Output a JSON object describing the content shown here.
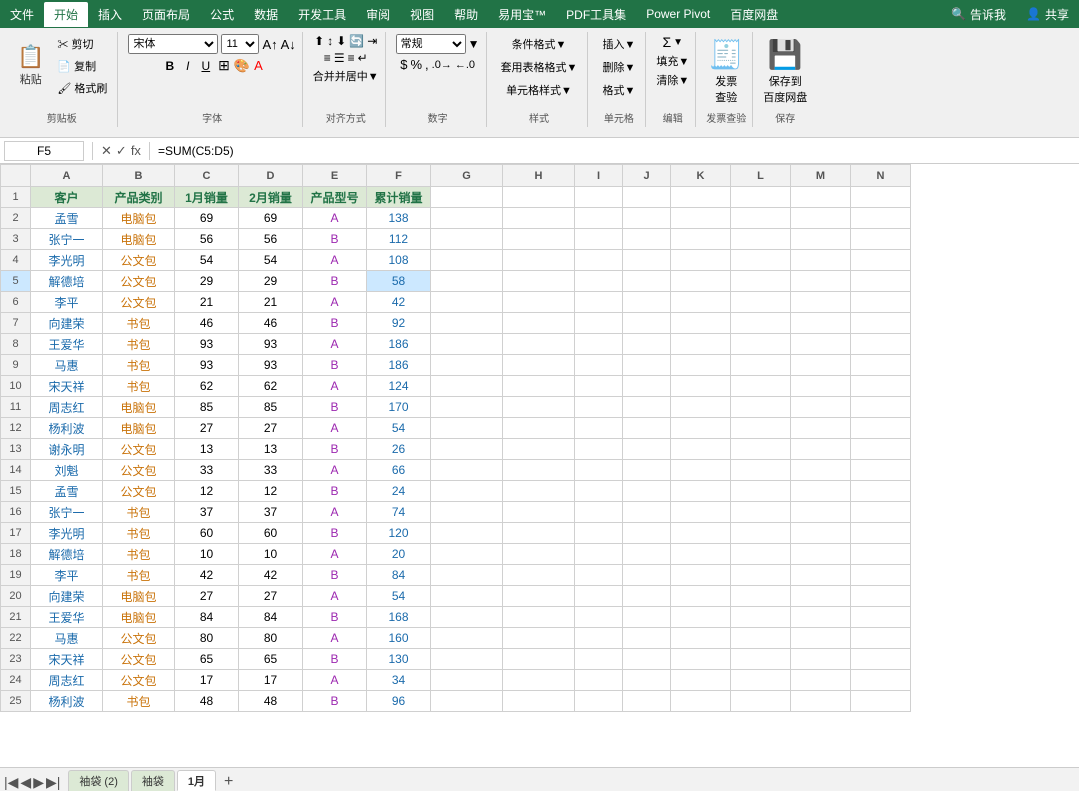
{
  "menuBar": {
    "items": [
      "文件",
      "开始",
      "插入",
      "页面布局",
      "公式",
      "数据",
      "开发工具",
      "审阅",
      "视图",
      "帮助",
      "易用宝™",
      "PDF工具集",
      "Power Pivot",
      "百度网盘"
    ],
    "activeItem": "开始",
    "rightItems": [
      "告诉我",
      "共享"
    ]
  },
  "ribbon": {
    "groups": [
      {
        "name": "剪贴板",
        "label": "剪贴板"
      },
      {
        "name": "字体",
        "label": "字体"
      },
      {
        "name": "对齐方式",
        "label": "对齐方式"
      },
      {
        "name": "数字",
        "label": "数字"
      },
      {
        "name": "样式",
        "label": "样式"
      },
      {
        "name": "单元格",
        "label": "单元格"
      },
      {
        "name": "编辑",
        "label": "编辑"
      },
      {
        "name": "发票查验",
        "label": "发票查验"
      },
      {
        "name": "保存",
        "label": "保存"
      }
    ]
  },
  "formulaBar": {
    "cellRef": "F5",
    "formula": "=SUM(C5:D5)"
  },
  "columns": [
    "A",
    "B",
    "C",
    "D",
    "E",
    "F",
    "G",
    "H",
    "I",
    "J",
    "K",
    "L",
    "M",
    "N"
  ],
  "headers": [
    "客户",
    "产品类别",
    "1月销量",
    "2月销量",
    "产品型号",
    "累计销量"
  ],
  "rows": [
    {
      "num": 2,
      "a": "孟雪",
      "b": "电脑包",
      "c": "69",
      "d": "69",
      "e": "A",
      "f": "138"
    },
    {
      "num": 3,
      "a": "张宁一",
      "b": "电脑包",
      "c": "56",
      "d": "56",
      "e": "B",
      "f": "112"
    },
    {
      "num": 4,
      "a": "李光明",
      "b": "公文包",
      "c": "54",
      "d": "54",
      "e": "A",
      "f": "108"
    },
    {
      "num": 5,
      "a": "解德培",
      "b": "公文包",
      "c": "29",
      "d": "29",
      "e": "B",
      "f": "58",
      "selected": true
    },
    {
      "num": 6,
      "a": "李平",
      "b": "公文包",
      "c": "21",
      "d": "21",
      "e": "A",
      "f": "42"
    },
    {
      "num": 7,
      "a": "向建荣",
      "b": "书包",
      "c": "46",
      "d": "46",
      "e": "B",
      "f": "92"
    },
    {
      "num": 8,
      "a": "王爱华",
      "b": "书包",
      "c": "93",
      "d": "93",
      "e": "A",
      "f": "186"
    },
    {
      "num": 9,
      "a": "马惠",
      "b": "书包",
      "c": "93",
      "d": "93",
      "e": "B",
      "f": "186"
    },
    {
      "num": 10,
      "a": "宋天祥",
      "b": "书包",
      "c": "62",
      "d": "62",
      "e": "A",
      "f": "124"
    },
    {
      "num": 11,
      "a": "周志红",
      "b": "电脑包",
      "c": "85",
      "d": "85",
      "e": "B",
      "f": "170"
    },
    {
      "num": 12,
      "a": "杨利波",
      "b": "电脑包",
      "c": "27",
      "d": "27",
      "e": "A",
      "f": "54"
    },
    {
      "num": 13,
      "a": "谢永明",
      "b": "公文包",
      "c": "13",
      "d": "13",
      "e": "B",
      "f": "26"
    },
    {
      "num": 14,
      "a": "刘魁",
      "b": "公文包",
      "c": "33",
      "d": "33",
      "e": "A",
      "f": "66"
    },
    {
      "num": 15,
      "a": "孟雪",
      "b": "公文包",
      "c": "12",
      "d": "12",
      "e": "B",
      "f": "24"
    },
    {
      "num": 16,
      "a": "张宁一",
      "b": "书包",
      "c": "37",
      "d": "37",
      "e": "A",
      "f": "74"
    },
    {
      "num": 17,
      "a": "李光明",
      "b": "书包",
      "c": "60",
      "d": "60",
      "e": "B",
      "f": "120"
    },
    {
      "num": 18,
      "a": "解德培",
      "b": "书包",
      "c": "10",
      "d": "10",
      "e": "A",
      "f": "20"
    },
    {
      "num": 19,
      "a": "李平",
      "b": "书包",
      "c": "42",
      "d": "42",
      "e": "B",
      "f": "84"
    },
    {
      "num": 20,
      "a": "向建荣",
      "b": "电脑包",
      "c": "27",
      "d": "27",
      "e": "A",
      "f": "54"
    },
    {
      "num": 21,
      "a": "王爱华",
      "b": "电脑包",
      "c": "84",
      "d": "84",
      "e": "B",
      "f": "168"
    },
    {
      "num": 22,
      "a": "马惠",
      "b": "公文包",
      "c": "80",
      "d": "80",
      "e": "A",
      "f": "160"
    },
    {
      "num": 23,
      "a": "宋天祥",
      "b": "公文包",
      "c": "65",
      "d": "65",
      "e": "B",
      "f": "130"
    },
    {
      "num": 24,
      "a": "周志红",
      "b": "公文包",
      "c": "17",
      "d": "17",
      "e": "A",
      "f": "34"
    },
    {
      "num": 25,
      "a": "杨利波",
      "b": "书包",
      "c": "48",
      "d": "48",
      "e": "B",
      "f": "96"
    }
  ],
  "sheetTabs": [
    "袖袋 (2)",
    "袖袋",
    "1月"
  ],
  "activeSheet": "1月",
  "colors": {
    "green": "#217346",
    "lightGreen": "#dce9d5",
    "blue": "#1a6aab",
    "orange": "#c9730a"
  }
}
